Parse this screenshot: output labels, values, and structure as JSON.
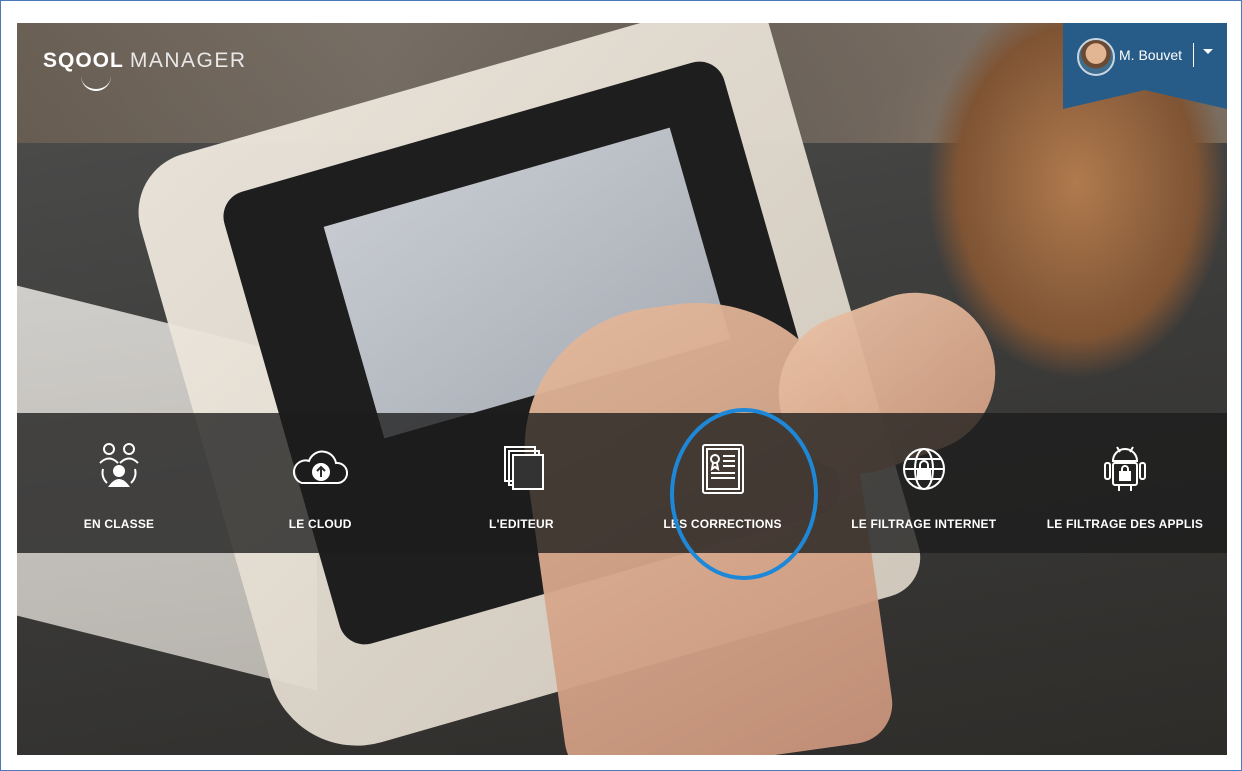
{
  "brand": {
    "logo_main": "SQOOL",
    "logo_sub": "MANAGER"
  },
  "user": {
    "name": "M. Bouvet",
    "avatar_icon": "user-avatar",
    "menu_icon": "caret-down-icon"
  },
  "menu": [
    {
      "label": "EN CLASSE",
      "icon": "users-class-icon"
    },
    {
      "label": "LE CLOUD",
      "icon": "cloud-upload-icon"
    },
    {
      "label": "L'EDITEUR",
      "icon": "stacked-pages-icon"
    },
    {
      "label": "LES CORRECTIONS",
      "icon": "certificate-document-icon",
      "highlighted": true
    },
    {
      "label": "LE FILTRAGE INTERNET",
      "icon": "globe-lock-icon"
    },
    {
      "label": "LE FILTRAGE DES APPLIS",
      "icon": "android-lock-icon"
    }
  ],
  "colors": {
    "banner": "#275c88",
    "highlight": "#1e88d8"
  }
}
